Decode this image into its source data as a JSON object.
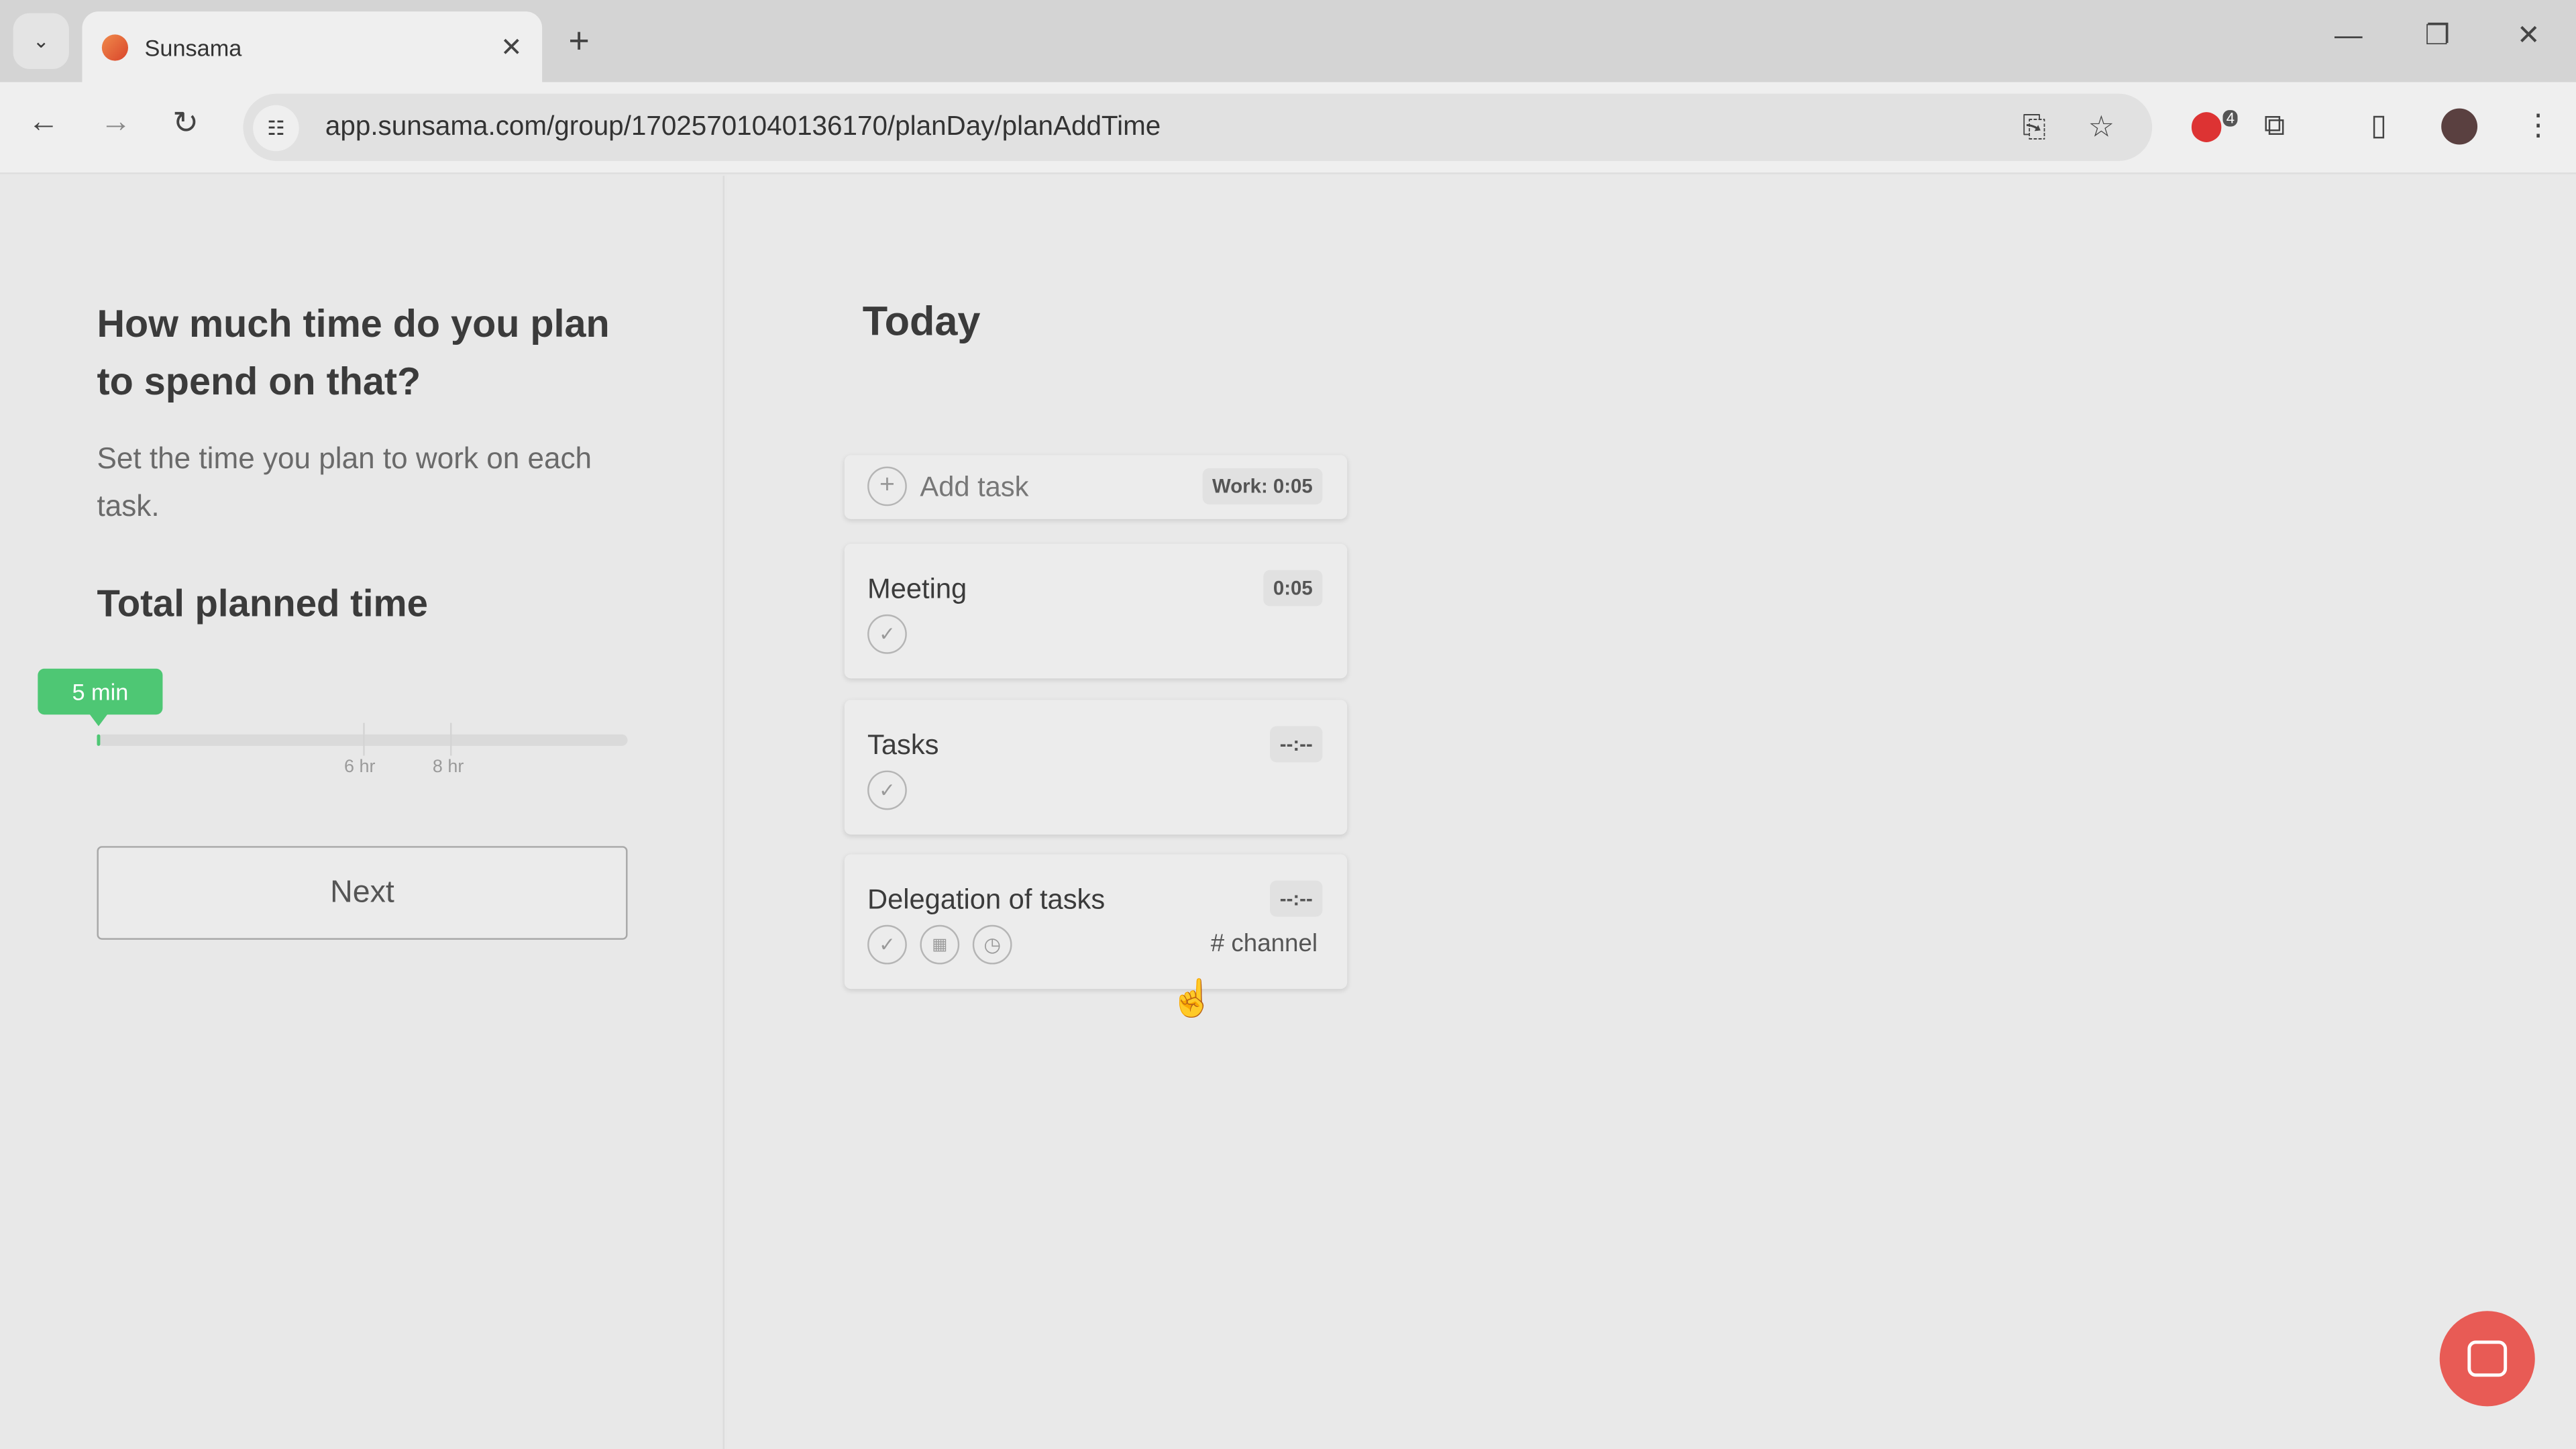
{
  "browser": {
    "tab_title": "Sunsama",
    "url": "app.sunsama.com/group/17025701040136170/planDay/planAddTime",
    "extension_badge": "4"
  },
  "left": {
    "heading": "How much time do you plan to spend on that?",
    "subtext": "Set the time you plan to work on each task.",
    "total_label": "Total planned time",
    "planned_value": "5 min",
    "planned_minutes": 5,
    "max_hours": 12,
    "ticks": [
      {
        "label": "6 hr",
        "hours": 6
      },
      {
        "label": "8 hr",
        "hours": 8
      }
    ],
    "next_label": "Next"
  },
  "main": {
    "title": "Today",
    "add_task": {
      "label": "Add task",
      "work": "Work: 0:05"
    },
    "tasks": [
      {
        "title": "Meeting",
        "time": "0:05"
      },
      {
        "title": "Tasks",
        "time": "--:--"
      },
      {
        "title": "Delegation of tasks",
        "time": "--:--",
        "channel": "channel"
      }
    ]
  },
  "colors": {
    "accent": "#4ec774",
    "chat": "#e85b55"
  }
}
